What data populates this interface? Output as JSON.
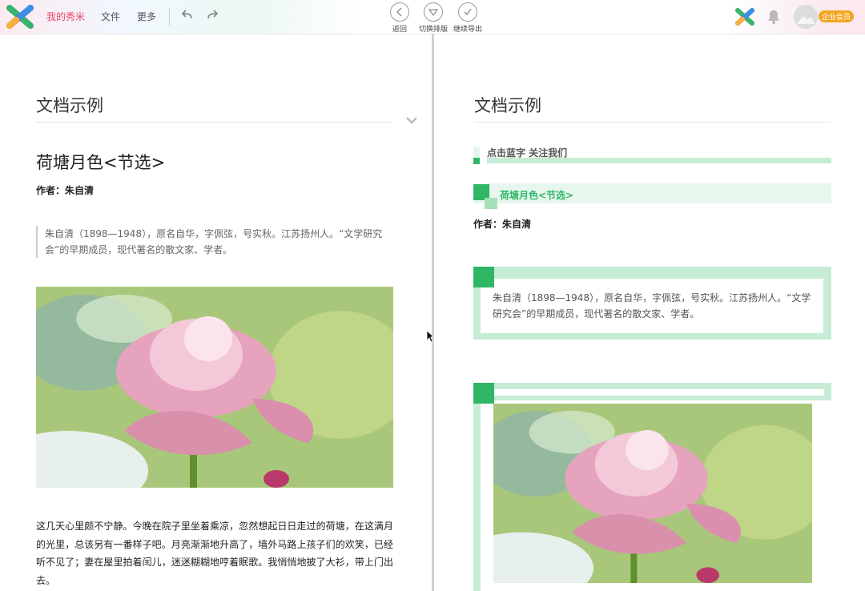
{
  "topbar": {
    "nav": [
      "我的秀米",
      "文件",
      "更多"
    ],
    "tools": [
      {
        "label": "返回",
        "icon": "back-icon"
      },
      {
        "label": "切换排版",
        "icon": "switch-layout-icon"
      },
      {
        "label": "继续导出",
        "icon": "export-icon"
      }
    ],
    "badge": "企业会员"
  },
  "left": {
    "doc_title": "文档示例",
    "article_title": "荷塘月色<节选>",
    "author": "作者：朱自清",
    "quote": "朱自清（1898—1948），原名自华，字佩弦，号实秋。江苏扬州人。“文学研究会”的早期成员，现代著名的散文家、学者。",
    "paragraph": "这几天心里颇不宁静。今晚在院子里坐着乘凉，忽然想起日日走过的荷塘，在这满月的光里，总该另有一番样子吧。月亮渐渐地升高了，墙外马路上孩子们的欢笑，已经听不见了；妻在屋里拍着闰儿，迷迷糊糊地哼着眠歌。我悄悄地披了大衫，带上门出去。"
  },
  "right": {
    "doc_title": "文档示例",
    "follow": "点击蓝字 关注我们",
    "heading": "荷塘月色<节选>",
    "author": "作者：朱自清",
    "quote": "朱自清（1898—1948），原名自华，字佩弦，号实秋。江苏扬州人。“文学研究会”的早期成员，现代著名的散文家、学者。"
  },
  "colors": {
    "accent_green": "#2fb766",
    "light_green": "#c6ecd5",
    "brand_pink": "#e8476a",
    "badge_orange": "#f4a623"
  }
}
